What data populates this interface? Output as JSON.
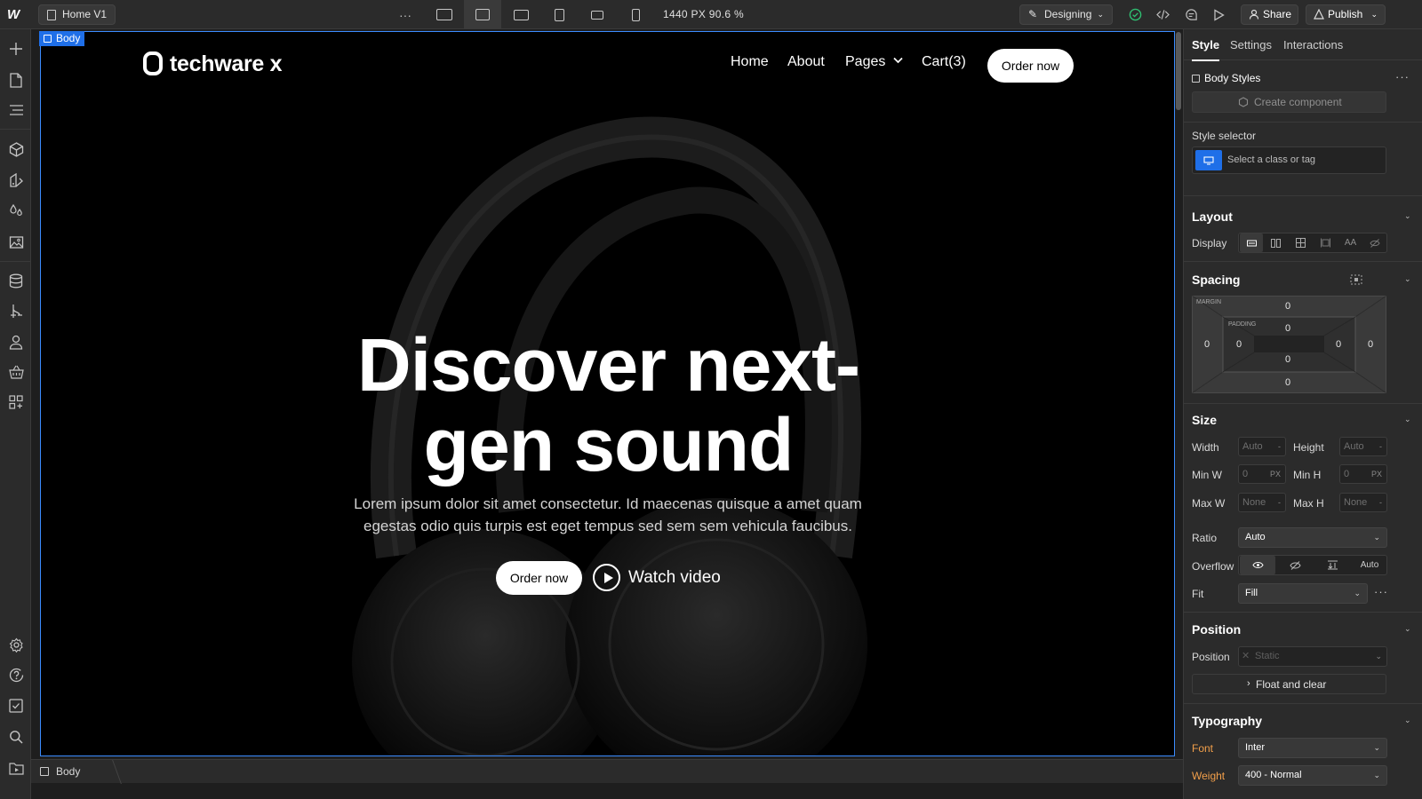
{
  "topbar": {
    "logo": "W",
    "page_name": "Home V1",
    "more": "···",
    "dimensions": "1440 PX  90.6 %",
    "mode_label": "Designing",
    "share_label": "Share",
    "publish_label": "Publish"
  },
  "canvas": {
    "selected_tag": "Body",
    "site": {
      "logo_text": "techware x",
      "nav": {
        "home": "Home",
        "about": "About",
        "pages": "Pages",
        "cart": "Cart(3)",
        "order": "Order now"
      },
      "hero": {
        "title_line1": "Discover next-",
        "title_line2": "gen sound",
        "subtitle_line1": "Lorem ipsum dolor sit amet consectetur. Id maecenas quisque a amet quam",
        "subtitle_line2": "egestas odio quis turpis est eget tempus sed sem sem vehicula faucibus.",
        "order_label": "Order now",
        "watch_label": "Watch video"
      }
    }
  },
  "breadcrumb": {
    "item": "Body"
  },
  "panel": {
    "tabs": [
      "Style",
      "Settings",
      "Interactions"
    ],
    "element_title": "Body Styles",
    "create_component": "Create component",
    "style_selector_label": "Style selector",
    "style_selector_placeholder": "Select a class or tag",
    "layout": {
      "title": "Layout",
      "display_label": "Display",
      "display_text_option": "AA"
    },
    "spacing": {
      "title": "Spacing",
      "margin_label": "MARGIN",
      "padding_label": "PADDING",
      "margin": {
        "top": "0",
        "right": "0",
        "bottom": "0",
        "left": "0"
      },
      "padding": {
        "top": "0",
        "right": "0",
        "bottom": "0",
        "left": "0"
      }
    },
    "size": {
      "title": "Size",
      "width_label": "Width",
      "width_value": "Auto",
      "width_unit": "-",
      "height_label": "Height",
      "height_value": "Auto",
      "height_unit": "-",
      "minw_label": "Min W",
      "minw_value": "0",
      "minw_unit": "PX",
      "minh_label": "Min H",
      "minh_value": "0",
      "minh_unit": "PX",
      "maxw_label": "Max W",
      "maxw_value": "None",
      "maxw_unit": "-",
      "maxh_label": "Max H",
      "maxh_value": "None",
      "maxh_unit": "-",
      "ratio_label": "Ratio",
      "ratio_value": "Auto",
      "overflow_label": "Overflow",
      "overflow_auto": "Auto",
      "fit_label": "Fit",
      "fit_value": "Fill"
    },
    "position": {
      "title": "Position",
      "position_label": "Position",
      "position_value": "Static",
      "float_label": "Float and clear"
    },
    "typography": {
      "title": "Typography",
      "font_label": "Font",
      "font_value": "Inter",
      "weight_label": "Weight",
      "weight_value": "400 - Normal"
    }
  },
  "colors": {
    "accent_blue": "#1f6fe8",
    "inherited_orange": "#f29f4a",
    "publish_check": "#2fbf71"
  }
}
